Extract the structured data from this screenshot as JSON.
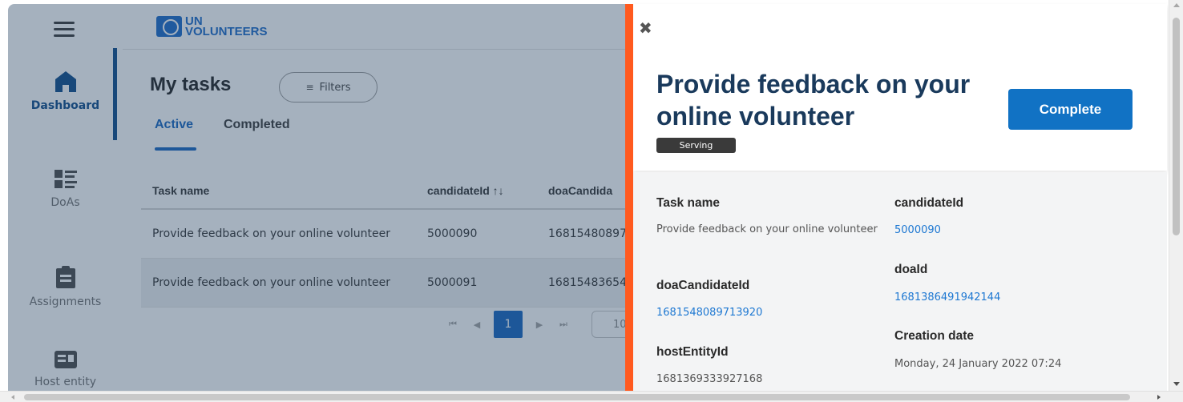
{
  "app": {
    "logo_line1": "UN",
    "logo_line2": "VOLUNTEERS"
  },
  "sidebar": {
    "items": [
      {
        "label": "Dashboard",
        "icon": "home-icon",
        "active": true
      },
      {
        "label": "DoAs",
        "icon": "list-icon",
        "active": false
      },
      {
        "label": "Assignments",
        "icon": "clipboard-icon",
        "active": false
      },
      {
        "label": "Host entity",
        "icon": "id-card-icon",
        "active": false
      }
    ]
  },
  "main": {
    "title": "My tasks",
    "filters_label": "Filters",
    "tabs": [
      {
        "label": "Active",
        "active": true
      },
      {
        "label": "Completed",
        "active": false
      }
    ],
    "table": {
      "columns": [
        "Task name",
        "candidateId ↑↓",
        "doaCandida"
      ],
      "rows": [
        [
          "Provide feedback on your online volunteer",
          "5000090",
          "16815480897"
        ],
        [
          "Provide feedback on your online volunteer",
          "5000091",
          "16815483654"
        ]
      ]
    },
    "pagination": {
      "current_page": "1",
      "page_size": "10"
    }
  },
  "panel": {
    "title": "Provide feedback on your online volunteer",
    "status": "Serving",
    "complete_label": "Complete",
    "fields": {
      "task_name": {
        "label": "Task name",
        "value": "Provide feedback on your online volunteer"
      },
      "candidate_id": {
        "label": "candidateId",
        "value": "5000090"
      },
      "doa_id": {
        "label": "doaId",
        "value": "1681386491942144"
      },
      "doa_candidate_id": {
        "label": "doaCandidateId",
        "value": "1681548089713920"
      },
      "creation_date": {
        "label": "Creation date",
        "value": "Monday, 24 January 2022 07:24"
      },
      "host_entity_id": {
        "label": "hostEntityId",
        "value": "1681369333927168"
      }
    }
  },
  "colors": {
    "accent_orange": "#ff5a1f",
    "primary_blue": "#1172c4",
    "title_navy": "#1a3a5c",
    "link_blue": "#1e78d2"
  }
}
